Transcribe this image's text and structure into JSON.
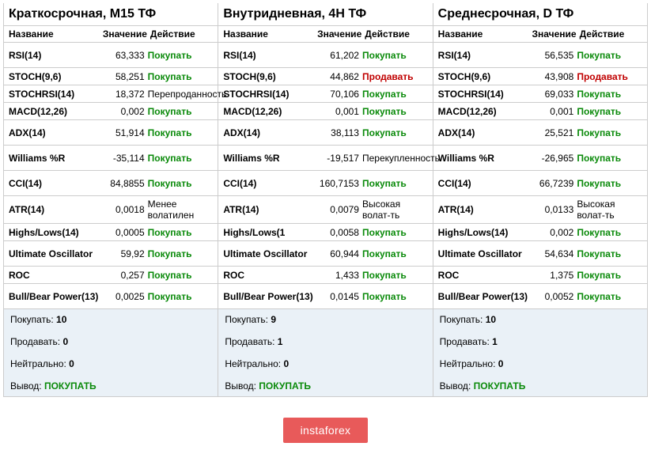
{
  "columns": [
    {
      "title": "Краткосрочная, М15 ТФ",
      "headers": {
        "name": "Название",
        "value": "Значение",
        "action": "Действие"
      },
      "rows": [
        {
          "name": "RSI(14)",
          "value": "63,333",
          "action": "Покупать",
          "cls": "buy",
          "tall": true
        },
        {
          "name": "STOCH(9,6)",
          "value": "58,251",
          "action": "Покупать",
          "cls": "buy"
        },
        {
          "name": "STOCHRSI(14)",
          "value": "18,372",
          "action": "Перепроданность",
          "cls": "neutral-txt"
        },
        {
          "name": "MACD(12,26)",
          "value": "0,002",
          "action": "Покупать",
          "cls": "buy"
        },
        {
          "name": "ADX(14)",
          "value": "51,914",
          "action": "Покупать",
          "cls": "buy",
          "tall": true
        },
        {
          "name": "Williams %R",
          "value": "-35,114",
          "action": "Покупать",
          "cls": "buy",
          "tall": true
        },
        {
          "name": "CCI(14)",
          "value": "84,8855",
          "action": "Покупать",
          "cls": "buy",
          "tall": true
        },
        {
          "name": "ATR(14)",
          "value": "0,0018",
          "action": "Менее волатилен",
          "cls": "neutral-txt"
        },
        {
          "name": "Highs/Lows(14)",
          "value": "0,0005",
          "action": "Покупать",
          "cls": "buy"
        },
        {
          "name": "Ultimate Oscillator",
          "value": "59,92",
          "action": "Покупать",
          "cls": "buy",
          "tall": true
        },
        {
          "name": "ROC",
          "value": "0,257",
          "action": "Покупать",
          "cls": "buy"
        },
        {
          "name": "Bull/Bear Power(13)",
          "value": "0,0025",
          "action": "Покупать",
          "cls": "buy",
          "tall": true
        }
      ],
      "summary": {
        "buy_label": "Покупать:",
        "buy": "10",
        "sell_label": "Продавать:",
        "sell": "0",
        "neutral_label": "Нейтрально:",
        "neutral": "0",
        "final_label": "Вывод:",
        "final": "ПОКУПАТЬ"
      }
    },
    {
      "title": "Внутридневная, 4Н ТФ",
      "headers": {
        "name": "Название",
        "value": "Значение",
        "action": "Действие"
      },
      "rows": [
        {
          "name": "RSI(14)",
          "value": "61,202",
          "action": "Покупать",
          "cls": "buy",
          "tall": true
        },
        {
          "name": "STOCH(9,6)",
          "value": "44,862",
          "action": "Продавать",
          "cls": "sell"
        },
        {
          "name": "STOCHRSI(14)",
          "value": "70,106",
          "action": "Покупать",
          "cls": "buy"
        },
        {
          "name": "MACD(12,26)",
          "value": "0,001",
          "action": "Покупать",
          "cls": "buy"
        },
        {
          "name": "ADX(14)",
          "value": "38,113",
          "action": "Покупать",
          "cls": "buy",
          "tall": true
        },
        {
          "name": "Williams %R",
          "value": "-19,517",
          "action": "Перекупленность",
          "cls": "neutral-txt",
          "tall": true
        },
        {
          "name": "CCI(14)",
          "value": "160,7153",
          "action": "Покупать",
          "cls": "buy",
          "tall": true
        },
        {
          "name": "ATR(14)",
          "value": "0,0079",
          "action": "Высокая волат-ть",
          "cls": "neutral-txt"
        },
        {
          "name": "Highs/Lows(1",
          "value": "0,0058",
          "action": "Покупать",
          "cls": "buy"
        },
        {
          "name": "Ultimate Oscillator",
          "value": "60,944",
          "action": "Покупать",
          "cls": "buy",
          "tall": true
        },
        {
          "name": "ROC",
          "value": "1,433",
          "action": "Покупать",
          "cls": "buy"
        },
        {
          "name": "Bull/Bear Power(13)",
          "value": "0,0145",
          "action": "Покупать",
          "cls": "buy",
          "tall": true
        }
      ],
      "summary": {
        "buy_label": "Покупать:",
        "buy": "9",
        "sell_label": "Продавать:",
        "sell": "1",
        "neutral_label": "Нейтрально:",
        "neutral": "0",
        "final_label": "Вывод:",
        "final": "ПОКУПАТЬ"
      }
    },
    {
      "title": "Среднесрочная, D ТФ",
      "headers": {
        "name": "Название",
        "value": "Значение",
        "action": "Действие"
      },
      "rows": [
        {
          "name": "RSI(14)",
          "value": "56,535",
          "action": "Покупать",
          "cls": "buy",
          "tall": true
        },
        {
          "name": "STOCH(9,6)",
          "value": "43,908",
          "action": "Продавать",
          "cls": "sell"
        },
        {
          "name": "STOCHRSI(14)",
          "value": "69,033",
          "action": "Покупать",
          "cls": "buy"
        },
        {
          "name": "MACD(12,26)",
          "value": "0,001",
          "action": "Покупать",
          "cls": "buy"
        },
        {
          "name": "ADX(14)",
          "value": "25,521",
          "action": "Покупать",
          "cls": "buy",
          "tall": true
        },
        {
          "name": "Williams %R",
          "value": "-26,965",
          "action": "Покупать",
          "cls": "buy",
          "tall": true
        },
        {
          "name": "CCI(14)",
          "value": "66,7239",
          "action": "Покупать",
          "cls": "buy",
          "tall": true
        },
        {
          "name": "ATR(14)",
          "value": "0,0133",
          "action": "Высокая волат-ть",
          "cls": "neutral-txt"
        },
        {
          "name": "Highs/Lows(14)",
          "value": "0,002",
          "action": "Покупать",
          "cls": "buy"
        },
        {
          "name": "Ultimate Oscillator",
          "value": "54,634",
          "action": "Покупать",
          "cls": "buy",
          "tall": true
        },
        {
          "name": "ROC",
          "value": "1,375",
          "action": "Покупать",
          "cls": "buy"
        },
        {
          "name": "Bull/Bear Power(13)",
          "value": "0,0052",
          "action": "Покупать",
          "cls": "buy",
          "tall": true
        }
      ],
      "summary": {
        "buy_label": "Покупать:",
        "buy": "10",
        "sell_label": "Продавать:",
        "sell": "1",
        "neutral_label": "Нейтрально:",
        "neutral": "0",
        "final_label": "Вывод:",
        "final": "ПОКУПАТЬ"
      }
    }
  ],
  "logo": "instaforex"
}
